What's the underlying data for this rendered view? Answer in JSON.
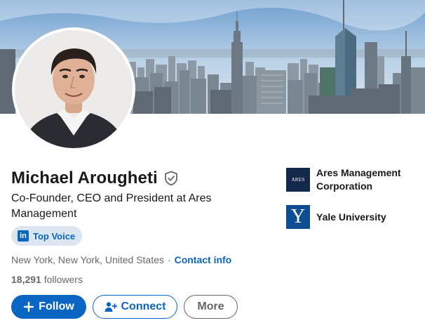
{
  "profile": {
    "name": "Michael Arougheti",
    "headline": "Co-Founder, CEO and President at Ares Management",
    "badge": {
      "logo_letters": "in",
      "label": "Top Voice"
    },
    "location": "New York, New York, United States",
    "separator": "·",
    "contact_label": "Contact info",
    "followers_count": "18,291",
    "followers_label": "followers"
  },
  "actions": {
    "follow_label": "Follow",
    "connect_label": "Connect",
    "more_label": "More"
  },
  "organizations": [
    {
      "name": "Ares Management Corporation",
      "logo_text": "ARES"
    },
    {
      "name": "Yale University",
      "logo_text": "Y"
    }
  ],
  "colors": {
    "accent": "#0a66c2",
    "badge_bg": "#dce6f1",
    "ares_logo": "#13294b",
    "yale_logo": "#0f4d92"
  },
  "icons": {
    "verified": "shield-check-icon",
    "follow": "plus-icon",
    "connect": "person-add-icon"
  }
}
